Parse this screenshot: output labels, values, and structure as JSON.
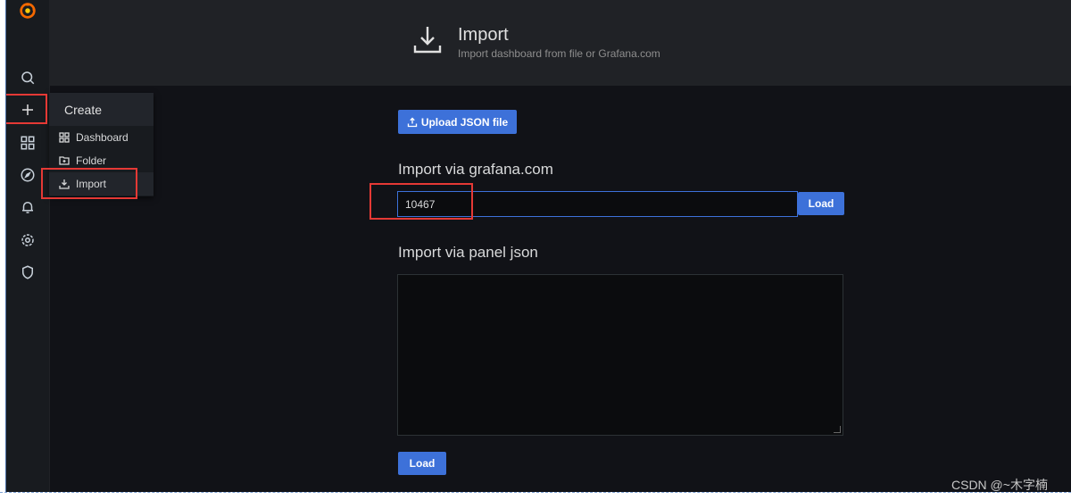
{
  "colors": {
    "background": "#111217",
    "sidemenu": "#181b1f",
    "header": "#202226",
    "primary": "#3d71d9",
    "highlight_box": "#e53935",
    "grafana_logo": "#f46800"
  },
  "sidemenu": {
    "icons": [
      "grafana-logo-icon",
      "search-icon",
      "plus-icon",
      "dashboards-icon",
      "explore-icon",
      "alerting-icon",
      "configuration-icon",
      "shield-icon"
    ]
  },
  "create_menu": {
    "header": "Create",
    "items": [
      {
        "label": "Dashboard",
        "icon": "apps-icon"
      },
      {
        "label": "Folder",
        "icon": "folder-plus-icon"
      },
      {
        "label": "Import",
        "icon": "import-icon"
      }
    ]
  },
  "page_header": {
    "icon": "import-icon",
    "title": "Import",
    "subtitle": "Import dashboard from file or Grafana.com"
  },
  "main": {
    "upload_button": "Upload JSON file",
    "gcom_title": "Import via grafana.com",
    "gcom_input_value": "10467",
    "gcom_load_button": "Load",
    "panel_json_title": "Import via panel json",
    "panel_json_value": "",
    "panel_load_button": "Load"
  },
  "watermark": "CSDN @~木字楠"
}
